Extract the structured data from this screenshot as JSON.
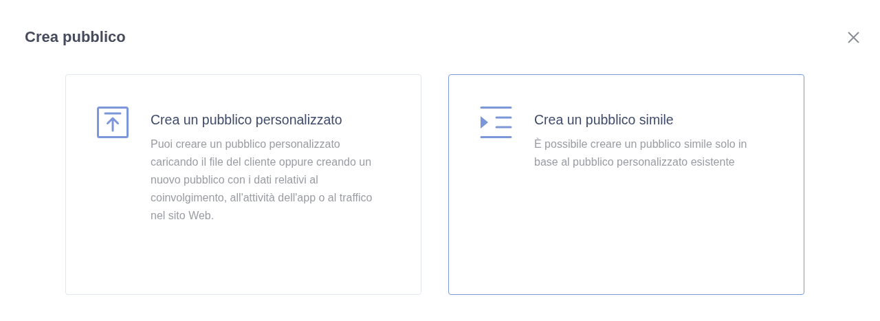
{
  "dialog": {
    "title": "Crea pubblico"
  },
  "options": [
    {
      "kind": "upload",
      "title": "Crea un pubblico personalizzato",
      "description": "Puoi creare un pubblico personalizzato caricando il file del cliente oppure creando un nuovo pubblico con i dati relativi al coinvolgimento, all'attività dell'app o al traffico nel sito Web.",
      "selected": false
    },
    {
      "kind": "list",
      "title": "Crea un pubblico simile",
      "description": "È possibile creare un pubblico simile solo in base al pubblico personalizzato esistente",
      "selected": true
    }
  ]
}
